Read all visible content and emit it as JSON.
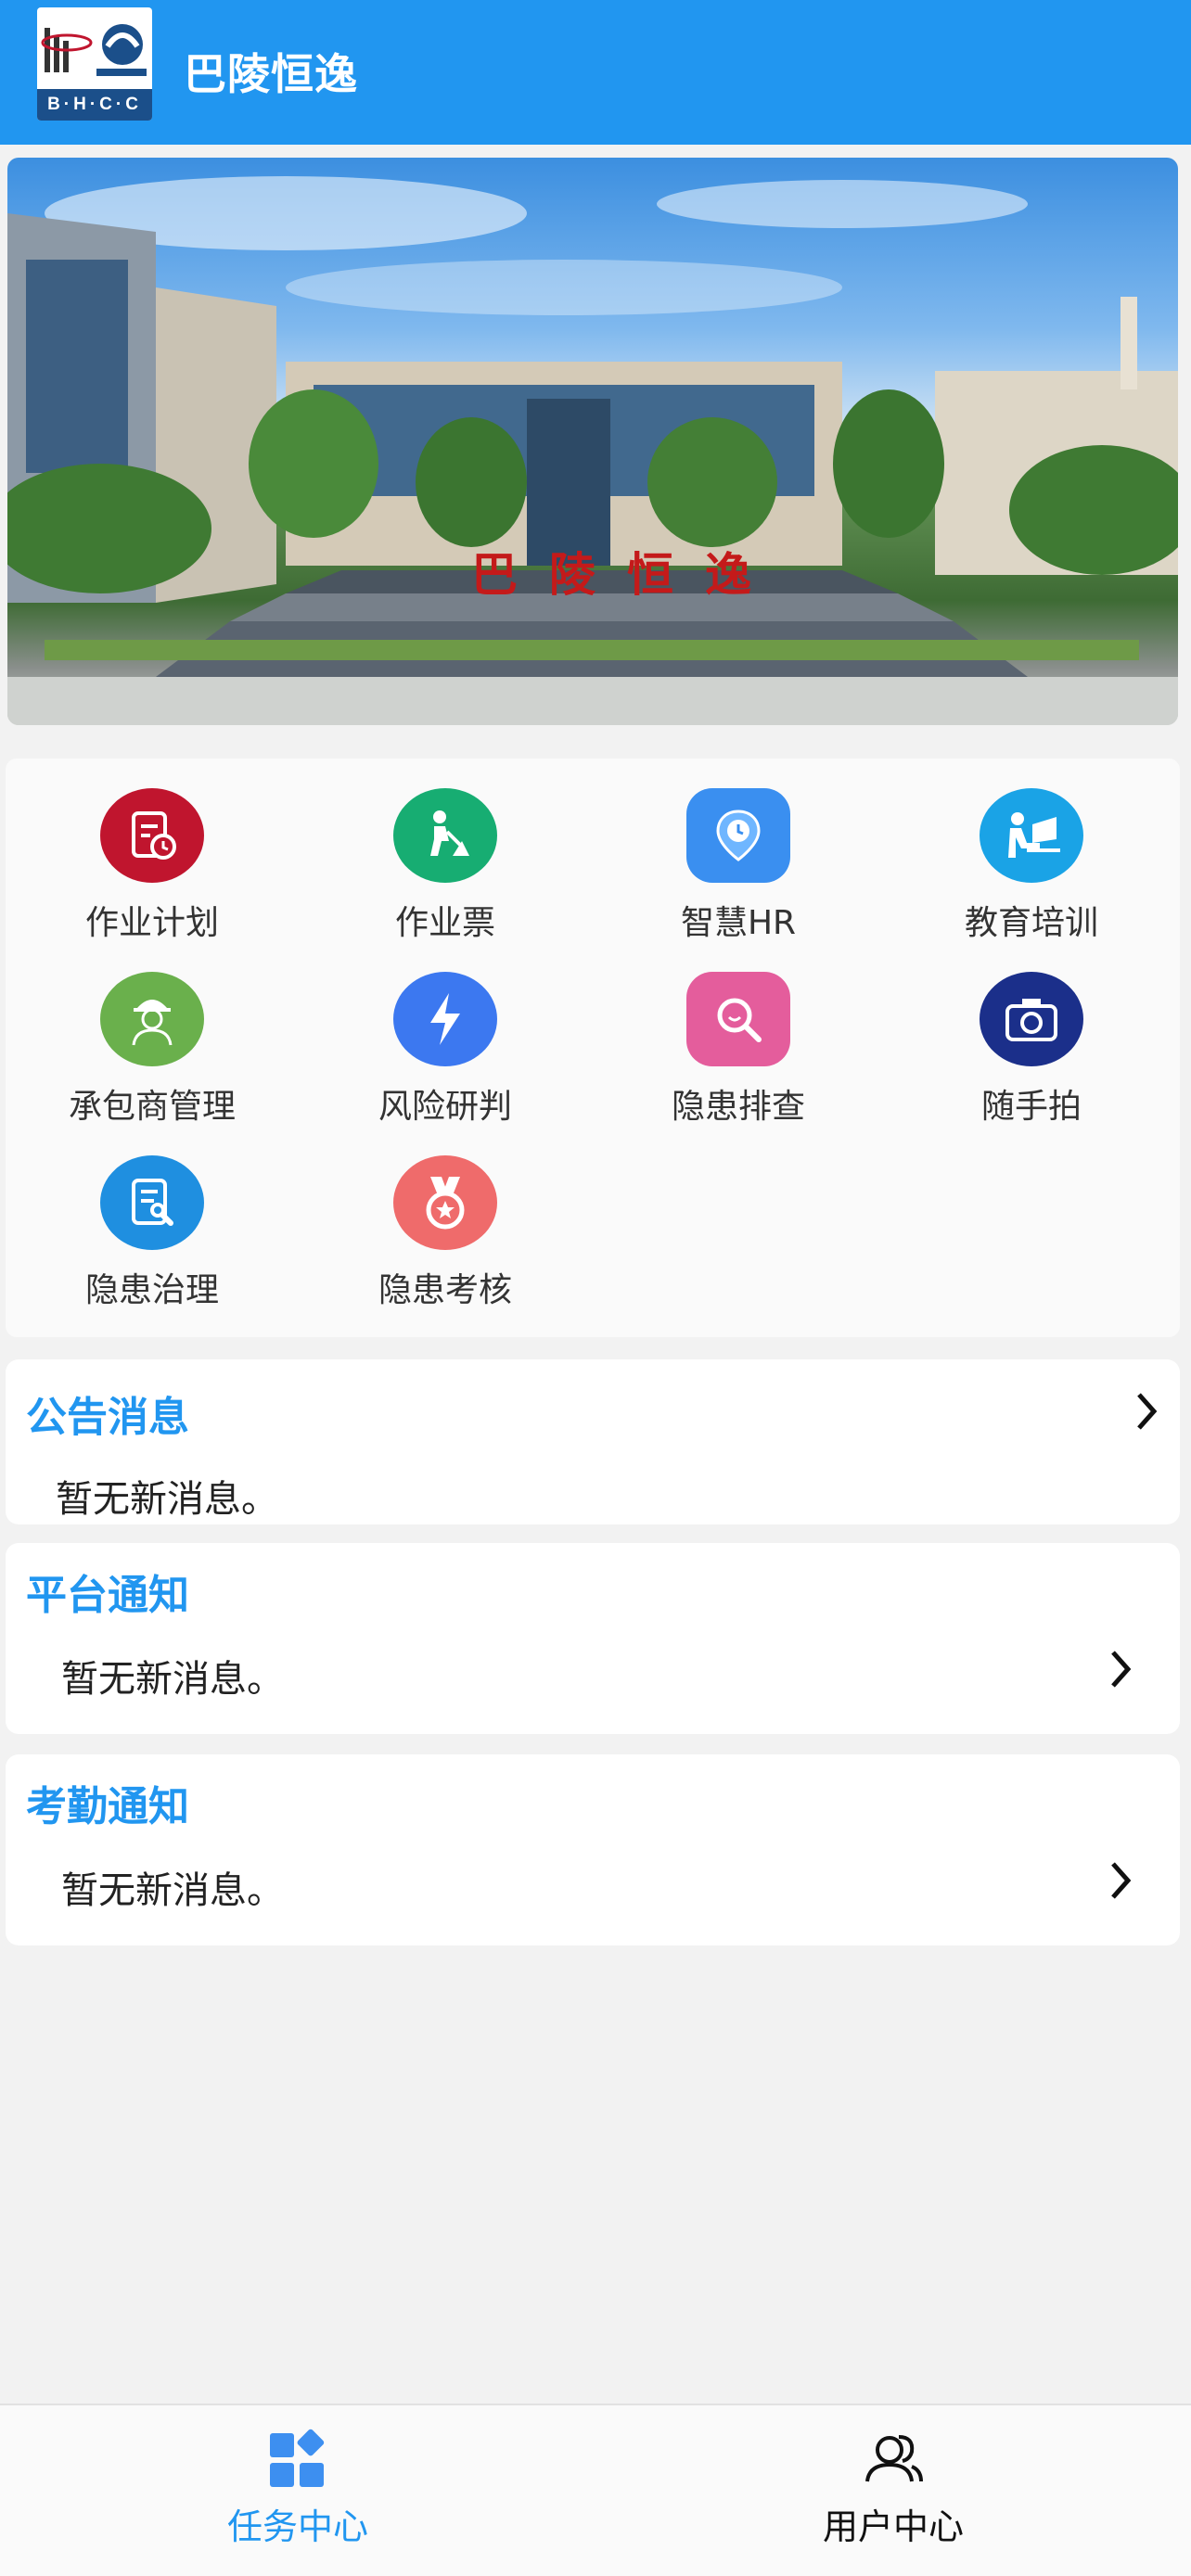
{
  "header": {
    "title": "巴陵恒逸",
    "logo_text": "B·H·C·C"
  },
  "banner": {
    "caption": "巴陵恒逸",
    "slides": 4,
    "active_slide": 1
  },
  "grid": [
    {
      "label": "作业计划",
      "icon": "calendar-clock-icon",
      "color": "#c0152e"
    },
    {
      "label": "作业票",
      "icon": "worker-shovel-icon",
      "color": "#17ad72"
    },
    {
      "label": "智慧HR",
      "icon": "location-clock-icon",
      "color": "#3a8ff0"
    },
    {
      "label": "教育培训",
      "icon": "study-desk-icon",
      "color": "#1aa3e6"
    },
    {
      "label": "承包商管理",
      "icon": "contractor-helmet-icon",
      "color": "#6ab04c"
    },
    {
      "label": "风险研判",
      "icon": "lightning-icon",
      "color": "#3c78f0"
    },
    {
      "label": "隐患排查",
      "icon": "magnifier-icon",
      "color": "#e45d9c"
    },
    {
      "label": "随手拍",
      "icon": "camera-icon",
      "color": "#1b2f8a"
    },
    {
      "label": "隐患治理",
      "icon": "document-wrench-icon",
      "color": "#1f8fe0"
    },
    {
      "label": "隐患考核",
      "icon": "medal-icon",
      "color": "#ef6b6b"
    }
  ],
  "notices": [
    {
      "title": "公告消息",
      "text": "暂无新消息。"
    },
    {
      "title": "平台通知",
      "text": "暂无新消息。"
    },
    {
      "title": "考勤通知",
      "text": "暂无新消息。"
    }
  ],
  "tabbar": {
    "tabs": [
      {
        "label": "任务中心",
        "icon": "apps-grid-icon",
        "active": true
      },
      {
        "label": "用户中心",
        "icon": "users-icon",
        "active": false
      }
    ],
    "active_color": "#2196f0"
  }
}
